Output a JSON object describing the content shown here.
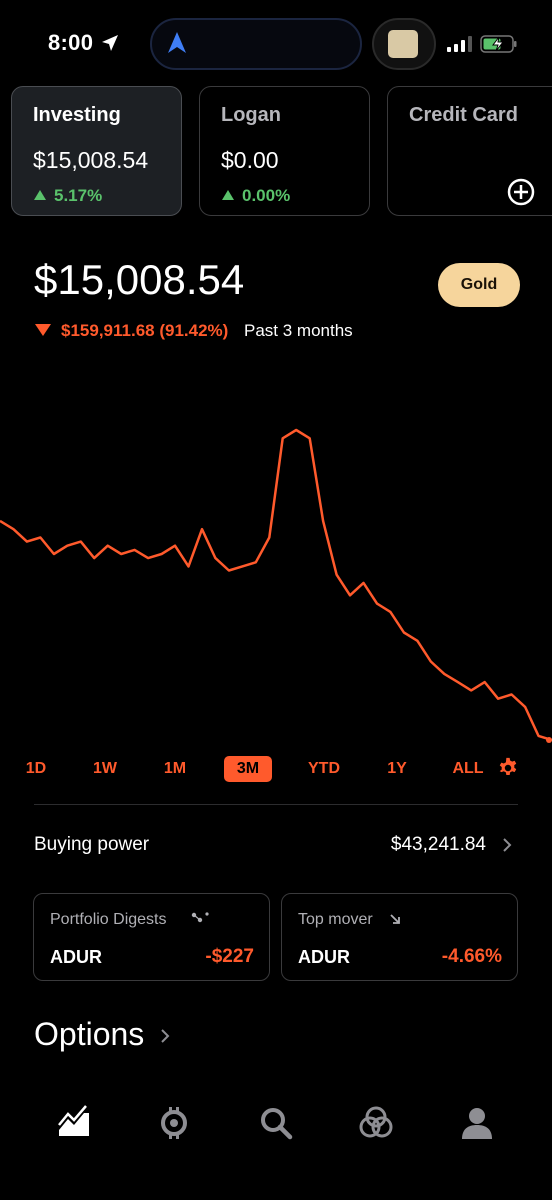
{
  "status_bar": {
    "time": "8:00"
  },
  "accounts": [
    {
      "name": "Investing",
      "value": "$15,008.54",
      "change": "5.17%",
      "active": true
    },
    {
      "name": "Logan",
      "value": "$0.00",
      "change": "0.00%",
      "active": false
    },
    {
      "name": "Credit Card",
      "value": "",
      "change": "",
      "active": false
    }
  ],
  "portfolio": {
    "value": "$15,008.54",
    "change": "$159,911.68 (91.42%)",
    "period": "Past 3 months",
    "gold_label": "Gold"
  },
  "chart_data": {
    "type": "line",
    "series": [
      {
        "color": "#ff5a2c",
        "values": [
          31.0,
          30.0,
          28.5,
          29.0,
          27.0,
          28.0,
          28.5,
          26.5,
          28.0,
          27.0,
          27.5,
          26.5,
          27.0,
          28.0,
          25.5,
          30.0,
          26.5,
          25.0,
          25.5,
          26.0,
          29.0,
          41.0,
          42.0,
          41.0,
          31.0,
          24.5,
          22.0,
          23.5,
          21.0,
          20.0,
          17.5,
          16.5,
          14.0,
          12.5,
          11.5,
          10.5,
          11.5,
          9.5,
          10.0,
          8.5,
          5.0,
          4.5
        ]
      }
    ],
    "grid": false,
    "legend": "none"
  },
  "ranges": {
    "items": [
      "1D",
      "1W",
      "1M",
      "3M",
      "YTD",
      "1Y",
      "ALL"
    ],
    "selected": "3M"
  },
  "buying_power": {
    "label": "Buying power",
    "value": "$43,241.84"
  },
  "cards": [
    {
      "title": "Portfolio Digests",
      "symbol": "ADUR",
      "value": "-$227"
    },
    {
      "title": "Top mover",
      "symbol": "ADUR",
      "value": "-4.66%"
    }
  ],
  "options": {
    "title": "Options"
  },
  "icons": {
    "tabs": [
      "chart-icon",
      "browse-icon",
      "search-icon",
      "crypto-icon",
      "account-icon"
    ]
  },
  "colors": {
    "accent": "#ff5a2c",
    "positive": "#5ac26b",
    "gold": "#f6d59c"
  }
}
